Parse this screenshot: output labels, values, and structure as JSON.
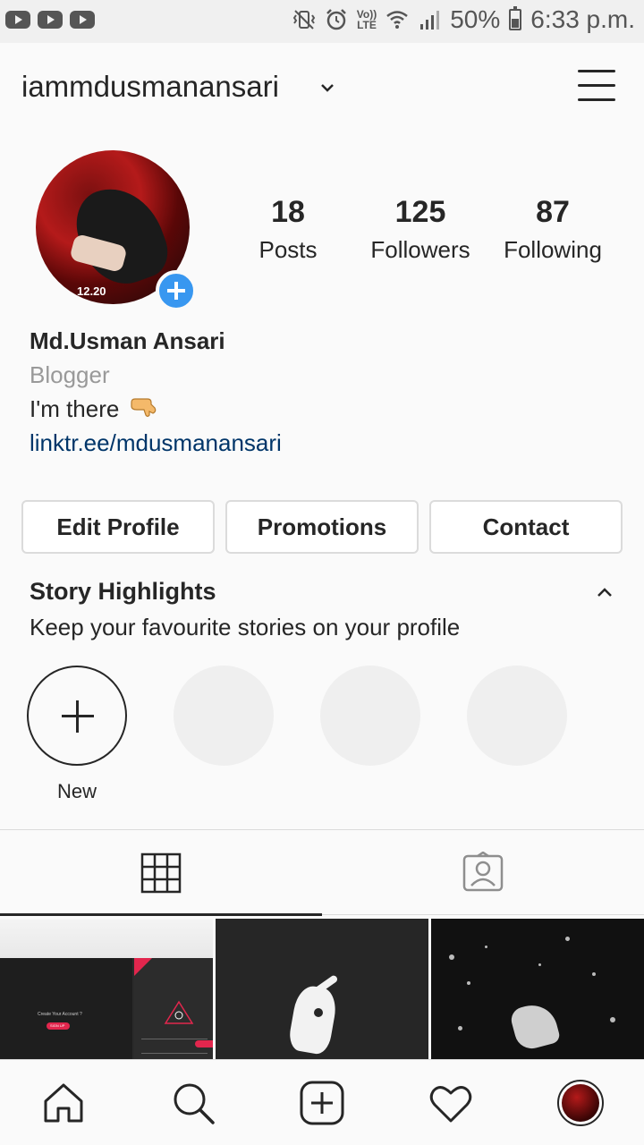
{
  "status_bar": {
    "battery_percent": "50%",
    "time": "6:33 p.m.",
    "network_label_top": "Vo))",
    "network_label_bottom": "LTE",
    "icons": [
      "youtube-icon",
      "youtube-icon",
      "youtube-icon",
      "vibrate-icon",
      "alarm-icon",
      "volte-icon",
      "wifi-icon",
      "signal-icon",
      "battery-icon"
    ]
  },
  "header": {
    "username": "iammdusmanansari",
    "dropdown_icon": "chevron-down-icon",
    "menu_icon": "hamburger-menu-icon"
  },
  "profile": {
    "avatar_caption": "12.20",
    "stats": [
      {
        "value": "18",
        "label": "Posts"
      },
      {
        "value": "125",
        "label": "Followers"
      },
      {
        "value": "87",
        "label": "Following"
      }
    ],
    "name": "Md.Usman Ansari",
    "category": "Blogger",
    "bio": "I'm there",
    "bio_emoji": "pointing-down-hand-icon",
    "link": "linktr.ee/mdusmanansari"
  },
  "actions": {
    "edit_profile": "Edit Profile",
    "promotions": "Promotions",
    "contact": "Contact"
  },
  "highlights": {
    "title": "Story Highlights",
    "subtitle": "Keep your favourite stories on your profile",
    "new_label": "New"
  },
  "tabs": {
    "items": [
      "grid-icon",
      "tagged-icon"
    ],
    "active": "grid"
  },
  "post_thumbnails": [
    {
      "caption": "Create Your Account ?",
      "button": "SIGN UP"
    },
    {
      "caption": ""
    },
    {
      "caption": ""
    }
  ],
  "bottom_nav": {
    "items": [
      "home-icon",
      "search-icon",
      "new-post-icon",
      "activity-heart-icon",
      "profile-avatar"
    ]
  },
  "colors": {
    "accent_blue": "#3897f0",
    "link_blue": "#003569",
    "text": "#262626",
    "muted": "#999999",
    "border": "#dbdbdb"
  }
}
